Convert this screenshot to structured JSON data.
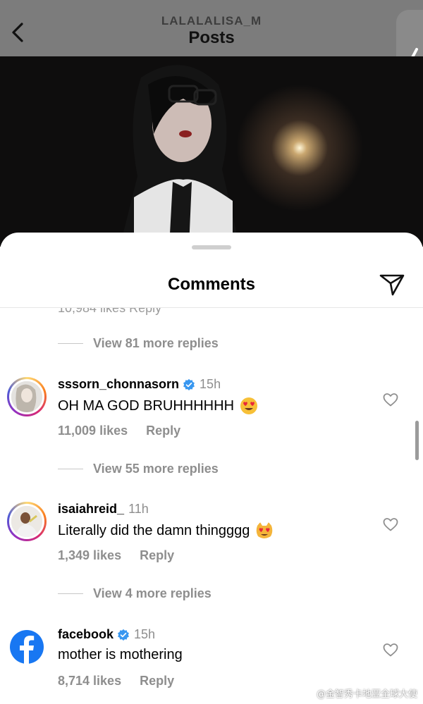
{
  "header": {
    "account_name": "LALALALISA_M",
    "title": "Posts"
  },
  "sheet": {
    "title": "Comments",
    "cut_off_row": "10,984 likes    Reply"
  },
  "view_more": [
    {
      "label": "View 81 more replies"
    },
    {
      "label": "View 55 more replies"
    },
    {
      "label": "View 4 more replies"
    }
  ],
  "comments": [
    {
      "username": "sssorn_chonnasorn",
      "verified": true,
      "time": "15h",
      "text": "OH MA GOD BRUHHHHHH",
      "emoji": "heart-eyes-emoji",
      "likes": "11,009 likes",
      "reply": "Reply"
    },
    {
      "username": "isaiahreid_",
      "verified": false,
      "time": "11h",
      "text": "Literally did the damn thingggg",
      "emoji": "heart-eyes-cat-emoji",
      "likes": "1,349 likes",
      "reply": "Reply"
    },
    {
      "username": "facebook",
      "verified": true,
      "time": "15h",
      "text": "mother is mothering",
      "emoji": "",
      "likes": "8,714 likes",
      "reply": "Reply"
    }
  ],
  "watermark": "@金智秀卡地亚全球大使",
  "colors": {
    "verified_blue": "#3897f0",
    "facebook_blue": "#1877f2",
    "muted_text": "#8e8e8e"
  }
}
